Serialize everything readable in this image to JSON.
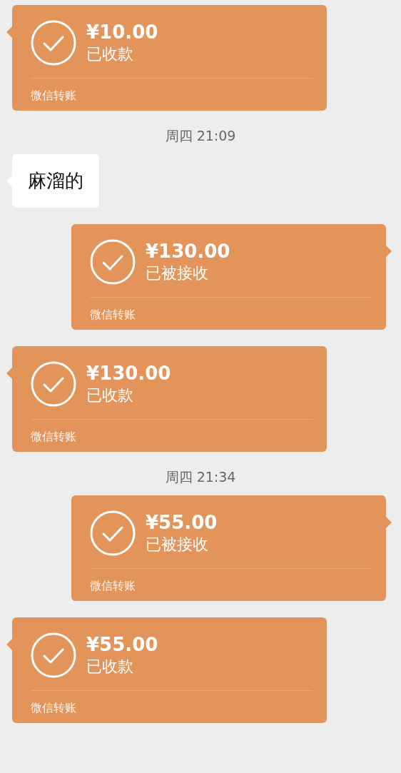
{
  "messages": [
    {
      "kind": "transfer",
      "outgoing": false,
      "amount": "¥10.00",
      "status": "已收款",
      "footer": "微信转账"
    },
    {
      "kind": "time",
      "text": "周四 21:09"
    },
    {
      "kind": "text",
      "outgoing": false,
      "text": "麻溜的"
    },
    {
      "kind": "transfer",
      "outgoing": true,
      "amount": "¥130.00",
      "status": "已被接收",
      "footer": "微信转账"
    },
    {
      "kind": "transfer",
      "outgoing": false,
      "amount": "¥130.00",
      "status": "已收款",
      "footer": "微信转账"
    },
    {
      "kind": "time",
      "text": "周四 21:34"
    },
    {
      "kind": "transfer",
      "outgoing": true,
      "amount": "¥55.00",
      "status": "已被接收",
      "footer": "微信转账"
    },
    {
      "kind": "transfer",
      "outgoing": false,
      "amount": "¥55.00",
      "status": "已收款",
      "footer": "微信转账"
    }
  ]
}
